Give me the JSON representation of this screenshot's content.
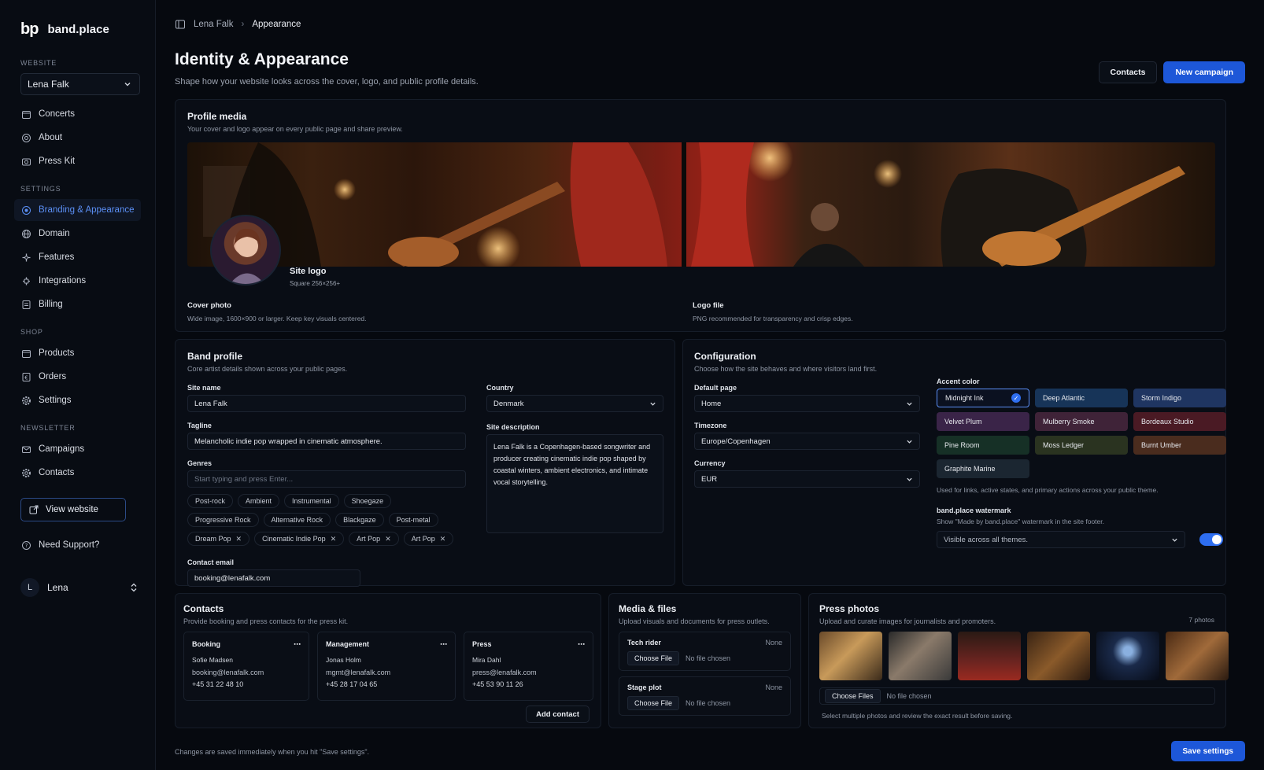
{
  "brand": {
    "logo": "bp",
    "name": "band.place"
  },
  "sidebar": {
    "website_label": "WEBSITE",
    "site_value": "Lena Falk",
    "website_items": [
      {
        "label": "Concerts"
      },
      {
        "label": "About"
      },
      {
        "label": "Press Kit"
      }
    ],
    "settings_label": "SETTINGS",
    "settings_items": [
      {
        "label": "Branding & Appearance"
      },
      {
        "label": "Domain"
      },
      {
        "label": "Features"
      },
      {
        "label": "Integrations"
      },
      {
        "label": "Billing"
      }
    ],
    "shop_label": "SHOP",
    "shop_items": [
      {
        "label": "Products"
      },
      {
        "label": "Orders"
      },
      {
        "label": "Settings"
      }
    ],
    "newsletter_label": "NEWSLETTER",
    "newsletter_items": [
      {
        "label": "Campaigns"
      },
      {
        "label": "Contacts"
      }
    ],
    "view_website": "View website",
    "support": "Need Support?",
    "user_initial": "L",
    "user_name": "Lena"
  },
  "breadcrumb": {
    "parent": "Lena Falk",
    "current": "Appearance"
  },
  "header": {
    "title": "Identity & Appearance",
    "subtitle": "Shape how your website looks across the cover, logo, and public profile details.",
    "contacts_btn": "Contacts",
    "campaign_btn": "New campaign"
  },
  "profile_media": {
    "title": "Profile media",
    "desc": "Your cover and logo appear on every public page and share preview.",
    "logo_title": "Site logo",
    "logo_desc": "Square 256×256+",
    "cover_label": "Cover photo",
    "cover_desc": "Wide image, 1600×900 or larger. Keep key visuals centered.",
    "logo_file_label": "Logo file",
    "logo_file_desc": "PNG recommended for transparency and crisp edges."
  },
  "band_profile": {
    "title": "Band profile",
    "desc": "Core artist details shown across your public pages.",
    "site_name_label": "Site name",
    "site_name": "Lena Falk",
    "tagline_label": "Tagline",
    "tagline": "Melancholic indie pop wrapped in cinematic atmosphere.",
    "genres_label": "Genres",
    "genres_placeholder": "Start typing and press Enter...",
    "genres": [
      "Post-rock",
      "Ambient",
      "Instrumental",
      "Shoegaze",
      "Progressive Rock",
      "Alternative Rock",
      "Blackgaze",
      "Post-metal",
      "Dream Pop",
      "Cinematic Indie Pop",
      "Art Pop",
      "Art Pop"
    ],
    "country_label": "Country",
    "country": "Denmark",
    "site_desc_label": "Site description",
    "site_desc": "Lena Falk is a Copenhagen-based songwriter and producer creating cinematic indie pop shaped by coastal winters, ambient electronics, and intimate vocal storytelling.",
    "email_label": "Contact email",
    "email": "booking@lenafalk.com"
  },
  "configuration": {
    "title": "Configuration",
    "desc": "Choose how the site behaves and where visitors land first.",
    "default_page_label": "Default page",
    "default_page": "Home",
    "timezone_label": "Timezone",
    "timezone": "Europe/Copenhagen",
    "currency_label": "Currency",
    "currency": "EUR",
    "accent_label": "Accent color",
    "accents": [
      {
        "name": "Midnight Ink",
        "color": "#0b1120"
      },
      {
        "name": "Deep Atlantic",
        "color": "#173458"
      },
      {
        "name": "Storm Indigo",
        "color": "#1f3561"
      },
      {
        "name": "Velvet Plum",
        "color": "#3a2448"
      },
      {
        "name": "Mulberry Smoke",
        "color": "#3f2338"
      },
      {
        "name": "Bordeaux Studio",
        "color": "#4a1a24"
      },
      {
        "name": "Pine Room",
        "color": "#163026"
      },
      {
        "name": "Moss Ledger",
        "color": "#2a3320"
      },
      {
        "name": "Burnt Umber",
        "color": "#4a2c1e"
      },
      {
        "name": "Graphite Marine",
        "color": "#1b2631"
      }
    ],
    "accent_help": "Used for links, active states, and primary actions across your public theme.",
    "watermark_label": "band.place watermark",
    "watermark_desc": "Show \"Made by band.place\" watermark in the site footer.",
    "watermark_value": "Visible across all themes."
  },
  "contacts": {
    "title": "Contacts",
    "desc": "Provide booking and press contacts for the press kit.",
    "items": [
      {
        "role": "Booking",
        "name": "Sofie Madsen",
        "email": "booking@lenafalk.com",
        "phone": "+45 31 22 48 10"
      },
      {
        "role": "Management",
        "name": "Jonas Holm",
        "email": "mgmt@lenafalk.com",
        "phone": "+45 28 17 04 65"
      },
      {
        "role": "Press",
        "name": "Mira Dahl",
        "email": "press@lenafalk.com",
        "phone": "+45 53 90 11 26"
      }
    ],
    "add_btn": "Add contact"
  },
  "media_files": {
    "title": "Media & files",
    "desc": "Upload visuals and documents for press outlets.",
    "tech_label": "Tech rider",
    "stage_label": "Stage plot",
    "none": "None",
    "choose": "Choose File",
    "no_file": "No file chosen"
  },
  "press_photos": {
    "title": "Press photos",
    "desc": "Upload and curate images for journalists and promoters.",
    "count": "7 photos",
    "choose": "Choose Files",
    "no_file": "No file chosen",
    "help": "Select multiple photos and review the exact result before saving."
  },
  "footer": {
    "note": "Changes are saved immediately when you hit \"Save settings\".",
    "save": "Save settings"
  }
}
